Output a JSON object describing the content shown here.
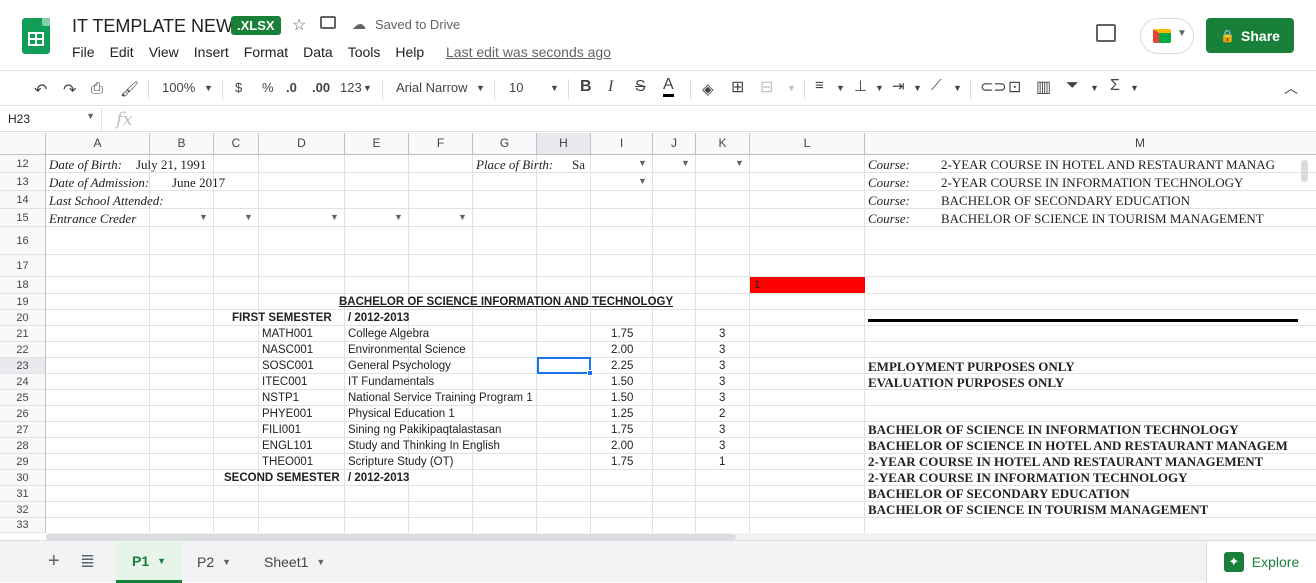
{
  "app": {
    "doc_title": "IT TEMPLATE NEW",
    "file_badge": ".XLSX",
    "saved_status": "Saved to Drive",
    "last_edit": "Last edit was seconds ago",
    "share_label": "Share",
    "accent_color": "#188038"
  },
  "menu": [
    "File",
    "Edit",
    "View",
    "Insert",
    "Format",
    "Data",
    "Tools",
    "Help"
  ],
  "toolbar": {
    "zoom": "100%",
    "currency": "$",
    "percent": "%",
    "dec_decrease": ".0",
    "dec_increase": ".00",
    "more_formats": "123",
    "font": "Arial Narrow",
    "font_size": "10",
    "bold": "B",
    "italic": "I",
    "strike": "S",
    "text_color": "A"
  },
  "formula_bar": {
    "name_box": "H23",
    "fx": "fx",
    "content": ""
  },
  "columns": [
    "A",
    "B",
    "C",
    "D",
    "E",
    "F",
    "G",
    "H",
    "I",
    "J",
    "K",
    "L",
    "M"
  ],
  "rows": [
    "12",
    "13",
    "14",
    "15",
    "16",
    "17",
    "18",
    "19",
    "20",
    "21",
    "22",
    "23",
    "24",
    "25",
    "26",
    "27",
    "28",
    "29",
    "30",
    "31",
    "32",
    "33"
  ],
  "cells": {
    "r12_label": "Date of Birth:",
    "r12_value": "July 21, 1991",
    "r12_place_label": "Place of  Birth:",
    "r12_place_value": "Sa",
    "r13_label": "Date of Admission:",
    "r13_value": "June 2017",
    "r14_label": "Last School Attended:",
    "r15_label": "Entrance Creder",
    "r18_l": "1",
    "r19_title": "BACHELOR OF SCIENCE INFORMATION AND TECHNOLOGY",
    "r20_sem": "FIRST SEMESTER",
    "r20_year": "/ 2012-2013",
    "r30_sem": "SECOND SEMESTER",
    "r30_year": "/ 2012-2013"
  },
  "courses": [
    {
      "code": "MATH001",
      "title": "College Algebra",
      "grade": "1.75",
      "units": "3"
    },
    {
      "code": "NASC001",
      "title": "Environmental Science",
      "grade": "2.00",
      "units": "3"
    },
    {
      "code": "SOSC001",
      "title": "General Psychology",
      "grade": "2.25",
      "units": "3"
    },
    {
      "code": "ITEC001",
      "title": "IT Fundamentals",
      "grade": "1.50",
      "units": "3"
    },
    {
      "code": "NSTP1",
      "title": "National Service Training Program 1",
      "grade": "1.50",
      "units": "3"
    },
    {
      "code": "PHYE001",
      "title": "Physical Education 1",
      "grade": "1.25",
      "units": "2"
    },
    {
      "code": "FILI001",
      "title": "Sining ng Pakikipaqtalastasan",
      "grade": "1.75",
      "units": "3"
    },
    {
      "code": "ENGL101",
      "title": "Study and Thinking In English",
      "grade": "2.00",
      "units": "3"
    },
    {
      "code": "THEO001",
      "title": "Scripture Study (OT)",
      "grade": "1.75",
      "units": "1"
    }
  ],
  "col_m": {
    "course_label": "Course:",
    "courses": [
      "2-YEAR COURSE IN HOTEL AND RESTAURANT MANAG",
      "2-YEAR COURSE IN INFORMATION TECHNOLOGY",
      "BACHELOR OF SECONDARY EDUCATION",
      "BACHELOR OF SCIENCE IN TOURISM MANAGEMENT"
    ],
    "r23": "EMPLOYMENT PURPOSES ONLY",
    "r24": "EVALUATION PURPOSES ONLY",
    "lower": [
      "BACHELOR OF SCIENCE IN INFORMATION TECHNOLOGY",
      "BACHELOR OF SCIENCE IN HOTEL AND RESTAURANT MANAGEM",
      "2-YEAR COURSE IN HOTEL AND RESTAURANT MANAGEMENT",
      "2-YEAR COURSE IN INFORMATION TECHNOLOGY",
      "BACHELOR OF SECONDARY EDUCATION",
      "BACHELOR OF SCIENCE IN TOURISM MANAGEMENT"
    ]
  },
  "sheets": [
    "P1",
    "P2",
    "Sheet1"
  ],
  "explore_label": "Explore",
  "colors": {
    "red_cell": "#ff0000",
    "selection": "#1a73e8"
  }
}
